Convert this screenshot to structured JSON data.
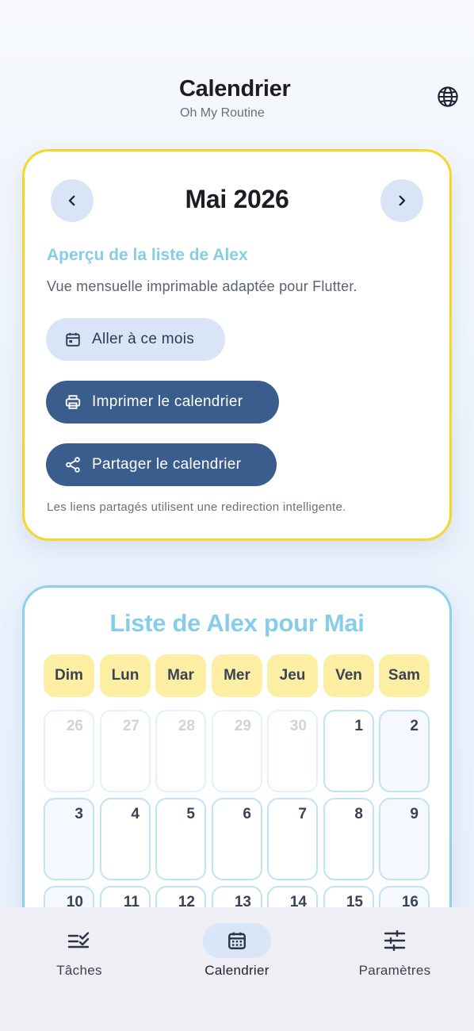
{
  "header": {
    "title": "Calendrier",
    "subtitle": "Oh My Routine",
    "language_icon": "globe-icon"
  },
  "month_card": {
    "month_label": "Mai 2026",
    "prev_icon": "chevron-left-icon",
    "next_icon": "chevron-right-icon",
    "preview_title": "Aperçu de la liste de Alex",
    "preview_description": "Vue mensuelle imprimable adaptée pour Flutter.",
    "goto_button": {
      "label": "Aller à ce mois",
      "icon": "calendar-icon"
    },
    "print_button": {
      "label": "Imprimer le calendrier",
      "icon": "printer-icon"
    },
    "share_button": {
      "label": "Partager le calendrier",
      "icon": "share-icon"
    },
    "share_note": "Les liens partagés utilisent une redirection intelligente."
  },
  "calendar": {
    "title": "Liste de Alex pour Mai",
    "weekdays": [
      "Dim",
      "Lun",
      "Mar",
      "Mer",
      "Jeu",
      "Ven",
      "Sam"
    ],
    "weeks": [
      [
        {
          "day": "26",
          "other_month": true
        },
        {
          "day": "27",
          "other_month": true
        },
        {
          "day": "28",
          "other_month": true
        },
        {
          "day": "29",
          "other_month": true
        },
        {
          "day": "30",
          "other_month": true
        },
        {
          "day": "1",
          "other_month": false
        },
        {
          "day": "2",
          "other_month": false
        }
      ],
      [
        {
          "day": "3",
          "other_month": false
        },
        {
          "day": "4",
          "other_month": false
        },
        {
          "day": "5",
          "other_month": false
        },
        {
          "day": "6",
          "other_month": false
        },
        {
          "day": "7",
          "other_month": false
        },
        {
          "day": "8",
          "other_month": false
        },
        {
          "day": "9",
          "other_month": false
        }
      ],
      [
        {
          "day": "10",
          "other_month": false
        },
        {
          "day": "11",
          "other_month": false
        },
        {
          "day": "12",
          "other_month": false
        },
        {
          "day": "13",
          "other_month": false
        },
        {
          "day": "14",
          "other_month": false
        },
        {
          "day": "15",
          "other_month": false
        },
        {
          "day": "16",
          "other_month": false
        }
      ]
    ]
  },
  "bottom_nav": {
    "items": [
      {
        "label": "Tâches",
        "icon": "task-list-icon",
        "active": false
      },
      {
        "label": "Calendrier",
        "icon": "calendar-icon",
        "active": true
      },
      {
        "label": "Paramètres",
        "icon": "sliders-icon",
        "active": false
      }
    ]
  },
  "colors": {
    "accent_yellow": "#f5d72a",
    "accent_light_blue": "#86cde8",
    "primary_button": "#3a5d8e",
    "secondary_button": "#d9e5f7"
  }
}
